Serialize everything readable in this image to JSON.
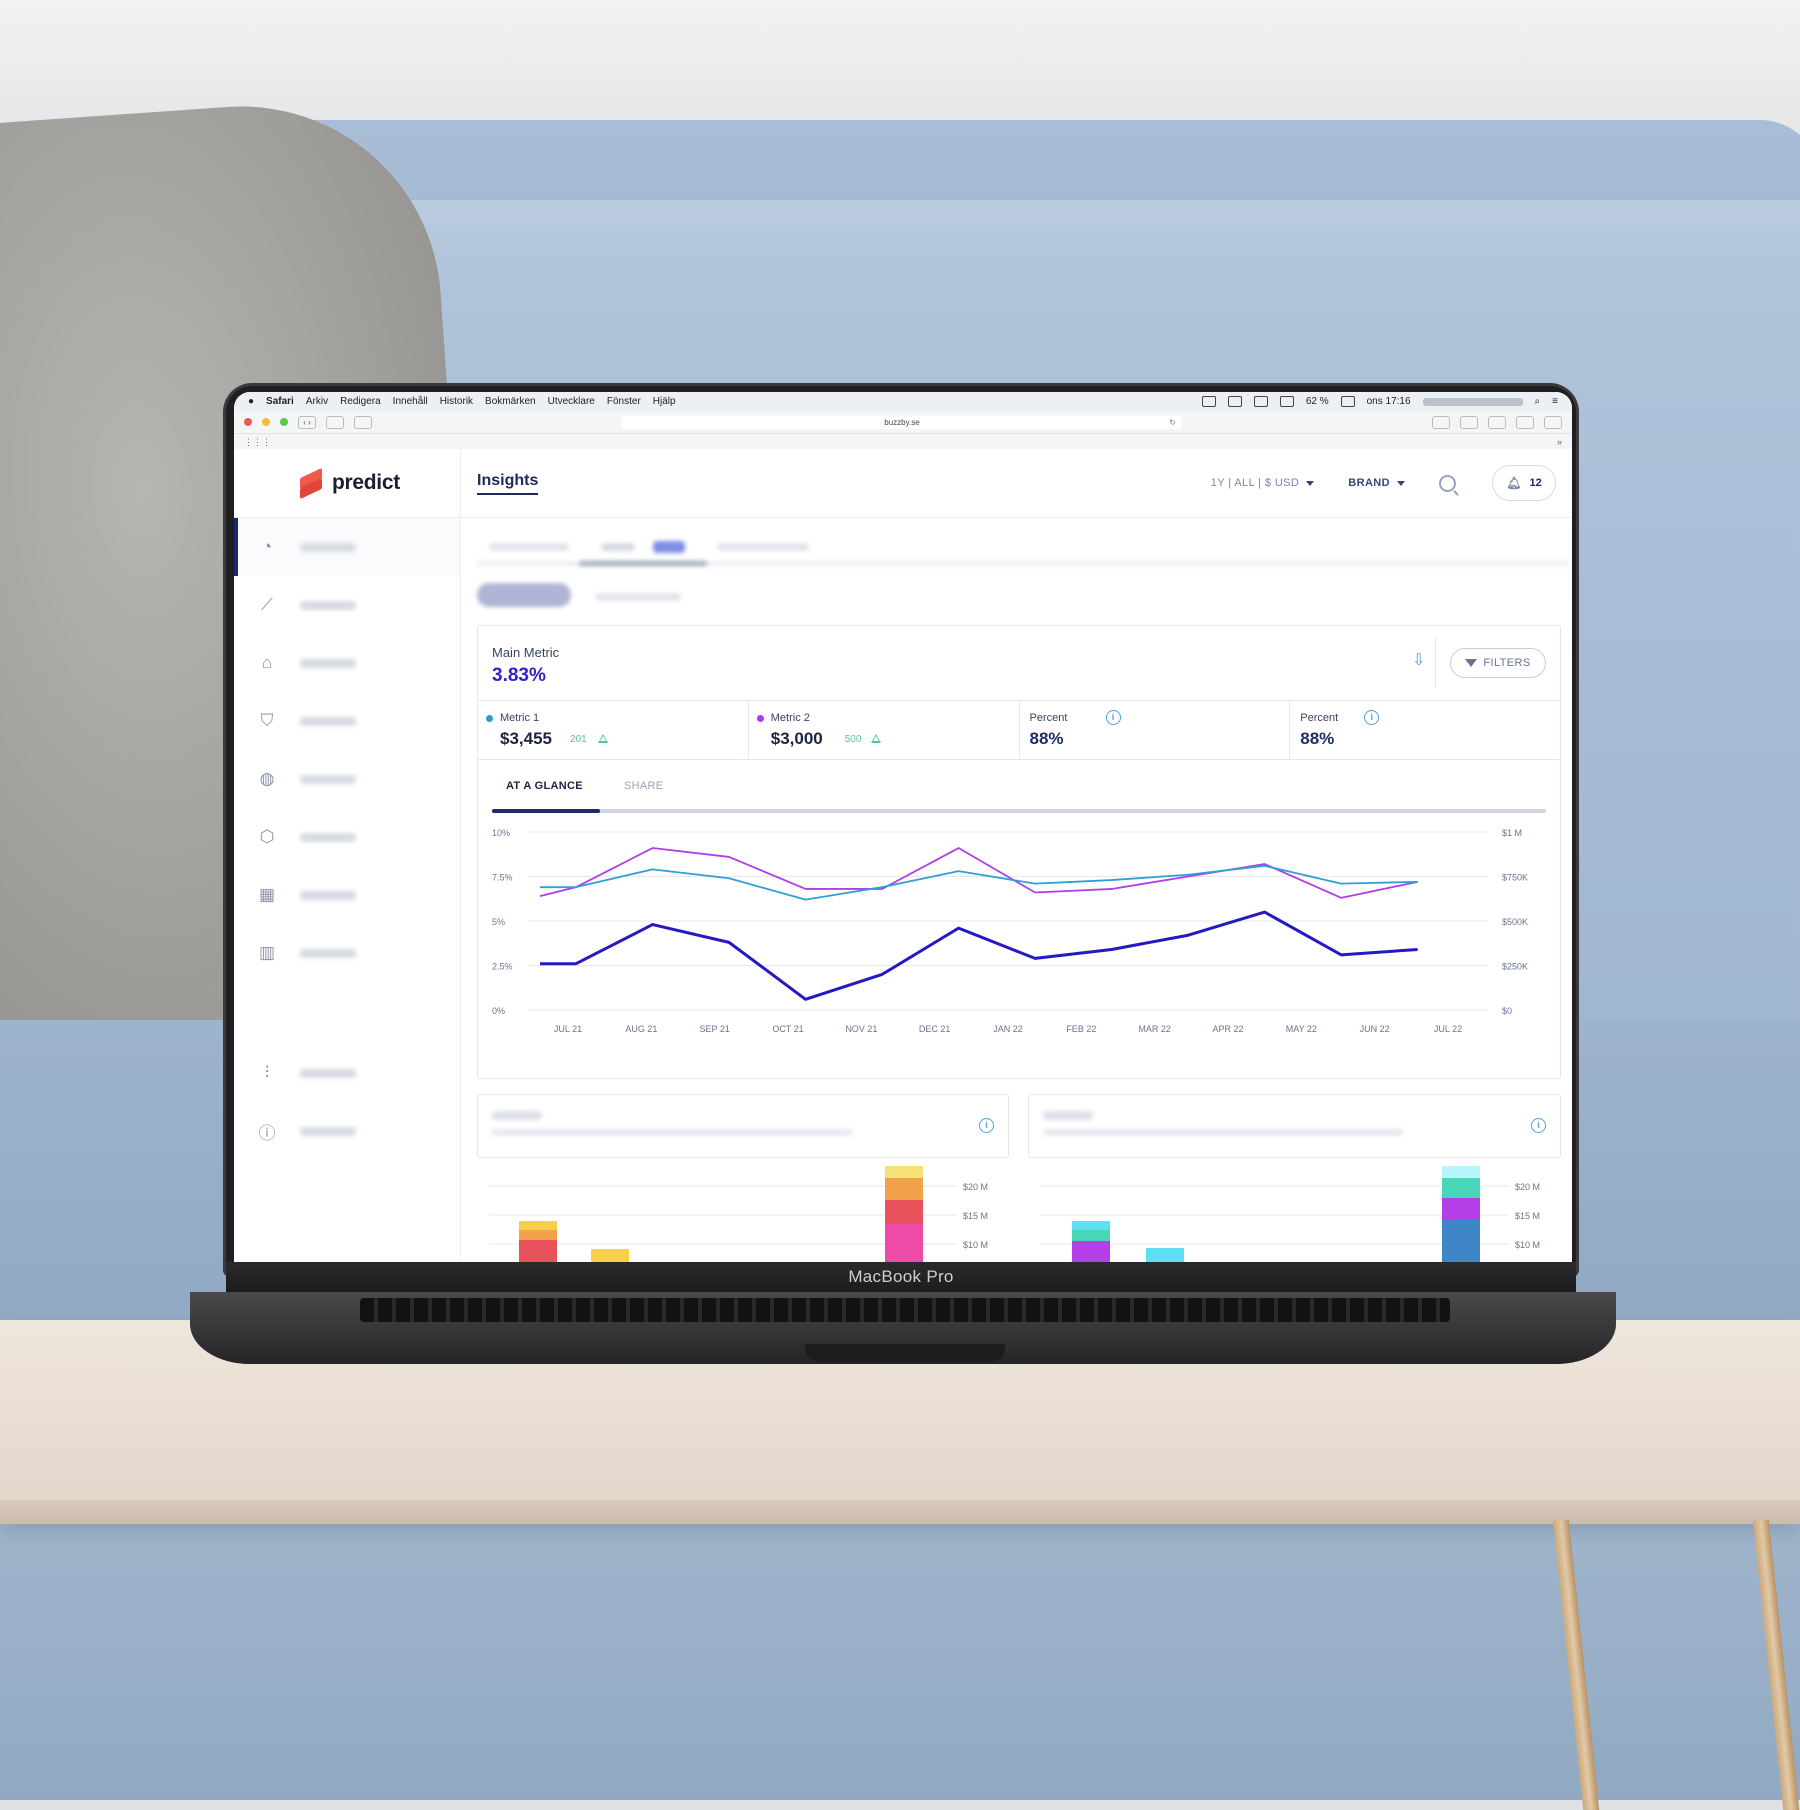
{
  "browser": {
    "menu_items": [
      "Safari",
      "Arkiv",
      "Redigera",
      "Innehåll",
      "Historik",
      "Bokmärken",
      "Utvecklare",
      "Fönster",
      "Hjälp"
    ],
    "battery": "62 %",
    "clock": "ons 17:16",
    "url": "buzzby.se",
    "favorites_toggle": "»"
  },
  "laptop_label": "MacBook Pro",
  "app": {
    "logo": "predict",
    "page_title": "Insights",
    "period_selector": "1Y  |  ALL  |  $ USD",
    "brand_selector": "BRAND",
    "notification_count": "12",
    "nav_icons": [
      "speedometer-icon",
      "trend-line-icon",
      "tag-icon",
      "shield-icon",
      "globe-icon",
      "box-icon",
      "store-icon",
      "bar-chart-icon"
    ],
    "nav_bottom_icons": [
      "sliders-icon",
      "info-icon"
    ]
  },
  "main_metric": {
    "label": "Main Metric",
    "value": "3.83%"
  },
  "filters_label": "FILTERS",
  "metrics": [
    {
      "label": "Metric 1",
      "value": "$3,455",
      "delta": "201",
      "dot_color": "#2b9ad8"
    },
    {
      "label": "Metric 2",
      "value": "$3,000",
      "delta": "500",
      "dot_color": "#b236e6"
    },
    {
      "label": "Percent",
      "value": "88%"
    },
    {
      "label": "Percent",
      "value": "88%"
    }
  ],
  "chart_tabs": {
    "active": "AT A GLANCE",
    "other": "SHARE"
  },
  "chart_data": [
    {
      "type": "line",
      "categories": [
        "JUL 21",
        "AUG 21",
        "SEP 21",
        "OCT 21",
        "NOV 21",
        "DEC 21",
        "JAN 22",
        "FEB 22",
        "MAR 22",
        "APR 22",
        "MAY 22",
        "JUN 22",
        "JUL 22"
      ],
      "y_left_ticks": [
        "10%",
        "7.5%",
        "5%",
        "2.5%",
        "0%"
      ],
      "y_right_ticks": [
        "$1 M",
        "$750K",
        "$500K",
        "$250K",
        "$0"
      ],
      "ylim": [
        0,
        10
      ],
      "grid": true,
      "series": [
        {
          "color": "#b03ee8",
          "x_offset_first": true,
          "values": [
            6.4,
            6.9,
            9.1,
            8.6,
            6.8,
            6.8,
            9.1,
            6.6,
            6.8,
            7.5,
            8.2,
            6.3,
            7.2
          ]
        },
        {
          "color": "#2f9fd6",
          "values": [
            6.9,
            6.9,
            7.9,
            7.4,
            6.2,
            6.9,
            7.8,
            7.1,
            7.3,
            7.6,
            8.1,
            7.1,
            7.2
          ]
        },
        {
          "color": "#2419c2",
          "values": [
            2.6,
            2.6,
            4.8,
            3.8,
            0.6,
            2.0,
            4.6,
            2.9,
            3.4,
            4.2,
            5.5,
            3.1,
            3.4
          ]
        }
      ]
    },
    {
      "type": "bar",
      "y_ticks": [
        "$20 M",
        "$15 M",
        "$10 M"
      ],
      "grid": true,
      "stack_colors": [
        "#e8525a",
        "#f2a24a",
        "#f6d04a",
        "#ee4aa8",
        "#f7e27a"
      ]
    },
    {
      "type": "bar",
      "y_ticks": [
        "$20 M",
        "$15 M",
        "$10 M"
      ],
      "grid": true,
      "stack_colors": [
        "#b63ee6",
        "#47d6b8",
        "#5fe0f0",
        "#3f86c6",
        "#b8f4fb"
      ]
    }
  ]
}
